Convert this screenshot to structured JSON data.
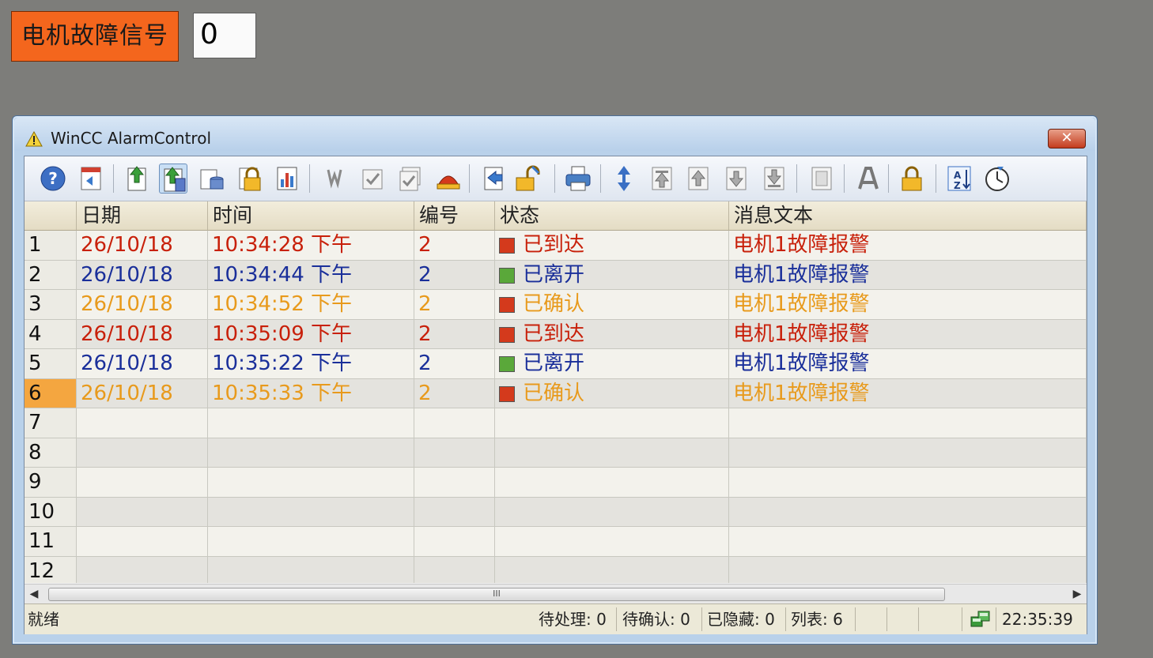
{
  "signal": {
    "label": "电机故障信号",
    "value": "0"
  },
  "window": {
    "title": "WinCC AlarmControl",
    "close_label": "✕"
  },
  "toolbar": {
    "icons": [
      "help-icon",
      "selection-dialog-icon",
      "current-alarms-icon",
      "archive-list-icon",
      "hidden-list-icon",
      "lock-list-icon",
      "hit-list-icon",
      "loop-in-alarm-icon",
      "single-acknowledge-icon",
      "group-acknowledge-icon",
      "horn-acknowledge-icon",
      "emergency-acknowledge-icon",
      "unlock-icon",
      "print-icon",
      "autoscroll-icon",
      "first-message-icon",
      "previous-message-icon",
      "next-message-icon",
      "last-message-icon",
      "info-text-icon",
      "comment-icon",
      "lock-icon",
      "sort-icon",
      "time-base-icon"
    ]
  },
  "grid": {
    "columns": [
      "日期",
      "时间",
      "编号",
      "状态",
      "消息文本"
    ],
    "rows": [
      {
        "num": "1",
        "date": "26/10/18",
        "time": "10:34:28 下午",
        "id": "2",
        "status": "已到达",
        "text": "电机1故障报警",
        "color": "#c8200a",
        "status_icon_color": "#d43a1c"
      },
      {
        "num": "2",
        "date": "26/10/18",
        "time": "10:34:44 下午",
        "id": "2",
        "status": "已离开",
        "text": "电机1故障报警",
        "color": "#1a2f9a",
        "status_icon_color": "#5aa83a"
      },
      {
        "num": "3",
        "date": "26/10/18",
        "time": "10:34:52 下午",
        "id": "2",
        "status": "已确认",
        "text": "电机1故障报警",
        "color": "#e89a1c",
        "status_icon_color": "#d43a1c"
      },
      {
        "num": "4",
        "date": "26/10/18",
        "time": "10:35:09 下午",
        "id": "2",
        "status": "已到达",
        "text": "电机1故障报警",
        "color": "#c8200a",
        "status_icon_color": "#d43a1c"
      },
      {
        "num": "5",
        "date": "26/10/18",
        "time": "10:35:22 下午",
        "id": "2",
        "status": "已离开",
        "text": "电机1故障报警",
        "color": "#1a2f9a",
        "status_icon_color": "#5aa83a"
      },
      {
        "num": "6",
        "date": "26/10/18",
        "time": "10:35:33 下午",
        "id": "2",
        "status": "已确认",
        "text": "电机1故障报警",
        "color": "#e89a1c",
        "status_icon_color": "#d43a1c"
      },
      {
        "num": "7"
      },
      {
        "num": "8"
      },
      {
        "num": "9"
      },
      {
        "num": "10"
      },
      {
        "num": "11"
      },
      {
        "num": "12"
      }
    ],
    "selected_row": "6"
  },
  "scrollbar": {
    "thumb_label": "III"
  },
  "statusbar": {
    "ready": "就绪",
    "pending": "待处理: 0",
    "to_ack": "待确认: 0",
    "hidden": "已隐藏: 0",
    "list": "列表: 6",
    "time": "22:35:39"
  }
}
